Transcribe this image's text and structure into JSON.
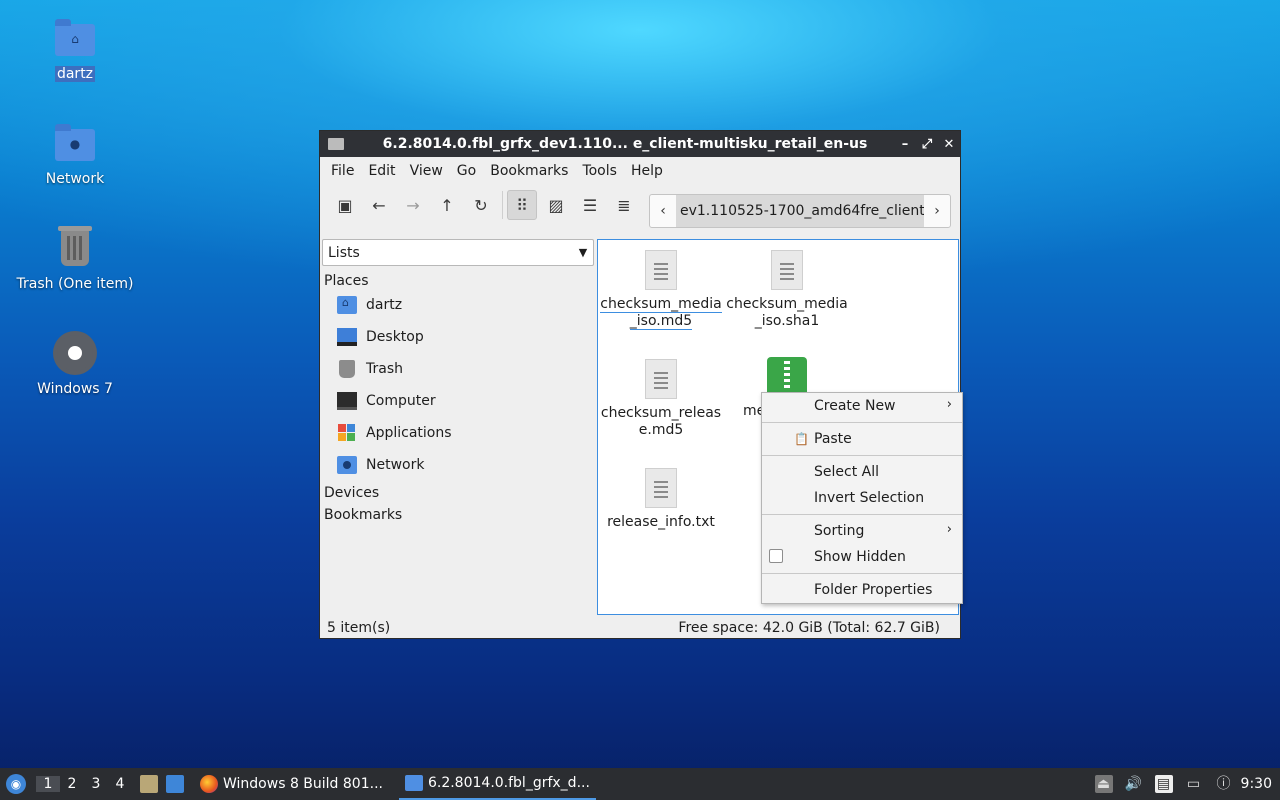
{
  "desktop": {
    "icons": [
      {
        "label": "dartz"
      },
      {
        "label": "Network"
      },
      {
        "label": "Trash (One item)"
      },
      {
        "label": "Windows 7"
      }
    ]
  },
  "window": {
    "title": "6.2.8014.0.fbl_grfx_dev1.110... e_client-multisku_retail_en-us",
    "controls": {
      "minimize": "–",
      "maximize": "⤢",
      "close": "✕"
    },
    "menu": [
      "File",
      "Edit",
      "View",
      "Go",
      "Bookmarks",
      "Tools",
      "Help"
    ],
    "toolbar_icons": [
      "new-tab-icon",
      "back-arrow-icon",
      "forward-arrow-icon",
      "up-arrow-icon",
      "reload-icon",
      "icon-view-icon",
      "thumbnail-view-icon",
      "compact-view-icon",
      "detailed-list-view-icon"
    ],
    "path": {
      "visible_text": "ev1.110525-1700_amd64fre_client-"
    },
    "sidebar": {
      "combo_value": "Lists",
      "places_header": "Places",
      "places": [
        {
          "label": "dartz",
          "icon": "home-folder-icon"
        },
        {
          "label": "Desktop",
          "icon": "desktop-icon"
        },
        {
          "label": "Trash",
          "icon": "trash-icon"
        },
        {
          "label": "Computer",
          "icon": "computer-icon"
        },
        {
          "label": "Applications",
          "icon": "applications-icon"
        },
        {
          "label": "Network",
          "icon": "network-icon"
        }
      ],
      "devices_header": "Devices",
      "bookmarks_header": "Bookmarks"
    },
    "files": [
      {
        "line1": "checksum_media",
        "line2": "_iso.md5"
      },
      {
        "line1": "checksum_media",
        "line2": "_iso.sha1"
      },
      {
        "line1": "checksum_releas",
        "line2": "e.md5"
      },
      {
        "line1": "me",
        "line2": ""
      },
      {
        "line1": "release_info.txt",
        "line2": ""
      }
    ],
    "status": {
      "items": "5 item(s)",
      "free": "Free space: 42.0 GiB (Total: 62.7 GiB)"
    }
  },
  "context_menu": {
    "create_new": "Create New",
    "paste": "Paste",
    "select_all": "Select All",
    "invert_selection": "Invert Selection",
    "sorting": "Sorting",
    "show_hidden": "Show Hidden",
    "folder_properties": "Folder Properties"
  },
  "taskbar": {
    "workspaces": [
      "1",
      "2",
      "3",
      "4"
    ],
    "tasks": [
      {
        "label": "Windows 8 Build 801..."
      },
      {
        "label": "6.2.8014.0.fbl_grfx_d..."
      }
    ],
    "clock": "9:30"
  },
  "colors": {
    "accent": "#3d8ee0",
    "titlebar": "#2f3136",
    "taskbar": "#2b2d31",
    "folder": "#4f8fe3",
    "archive": "#3aa648"
  }
}
